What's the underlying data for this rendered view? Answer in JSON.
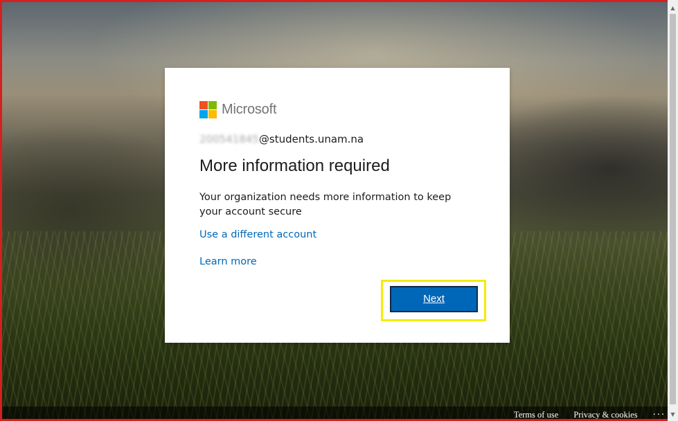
{
  "brand": {
    "name": "Microsoft",
    "logo_colors": [
      "#f25022",
      "#7fba00",
      "#00a4ef",
      "#ffb900"
    ]
  },
  "account": {
    "email_prefix_redacted": "200541845",
    "email_domain": "@students.unam.na"
  },
  "dialog": {
    "title": "More information required",
    "description": "Your organization needs more information to keep your account secure",
    "use_different_account": "Use a different account",
    "learn_more": "Learn more",
    "next_label": "Next"
  },
  "footer": {
    "terms": "Terms of use",
    "privacy": "Privacy & cookies",
    "more": "···"
  },
  "colors": {
    "accent": "#0067b8",
    "highlight": "#f5ec00",
    "frame": "#d62020"
  },
  "scrollbar": {
    "up_icon": "▲",
    "down_icon": "▼"
  }
}
